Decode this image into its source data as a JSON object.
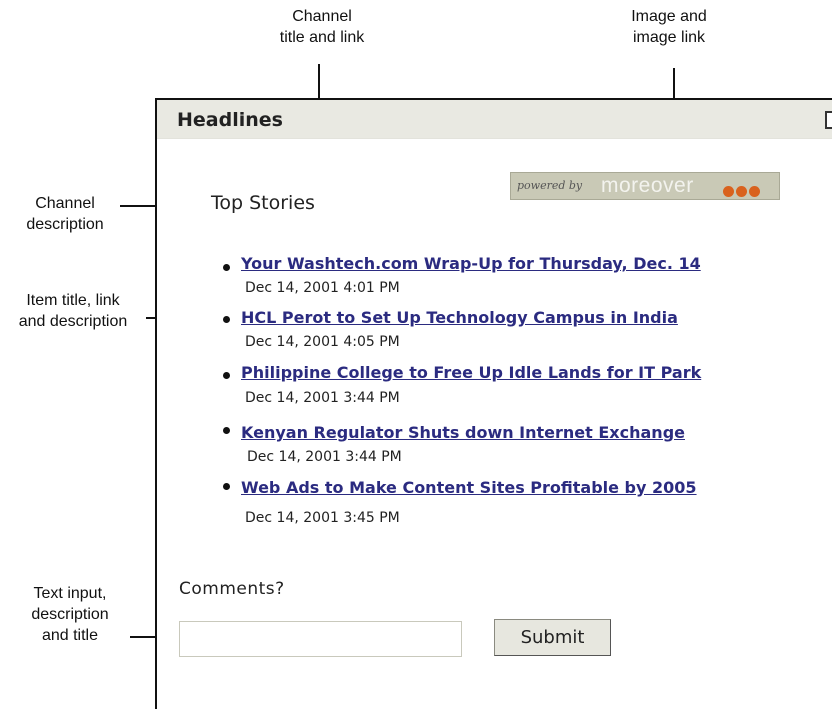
{
  "callouts": {
    "channel_title": [
      "Channel",
      "title and link"
    ],
    "image_link": [
      "Image and",
      "image link"
    ],
    "channel_description": [
      "Channel",
      "description"
    ],
    "item": [
      "Item title, link",
      "and description"
    ],
    "text_input": [
      "Text input,",
      "description",
      "and title"
    ]
  },
  "window": {
    "title": "Headlines"
  },
  "image": {
    "small_text": "powered by",
    "brand": "moreover",
    "dot_color": "#d9621e"
  },
  "channel": {
    "description": "Top Stories"
  },
  "items": [
    {
      "title": "Your Washtech.com Wrap-Up for Thursday, Dec. 14",
      "date": "Dec 14, 2001 4:01 PM"
    },
    {
      "title": "HCL Perot to Set Up Technology Campus in India",
      "date": "Dec 14, 2001 4:05 PM"
    },
    {
      "title": "Philippine College to Free Up Idle Lands for IT Park",
      "date": "Dec 14, 2001 3:44 PM"
    },
    {
      "title": "Kenyan Regulator Shuts down Internet Exchange",
      "date": "Dec 14, 2001 3:44 PM"
    },
    {
      "title": "Web Ads to Make Content Sites Profitable by 2005",
      "date": "Dec 14, 2001 3:45 PM"
    }
  ],
  "form": {
    "label": "Comments?",
    "input_value": "",
    "submit_label": "Submit"
  },
  "colors": {
    "link": "#2b2b80",
    "titlebar": "#e9e9e2"
  }
}
